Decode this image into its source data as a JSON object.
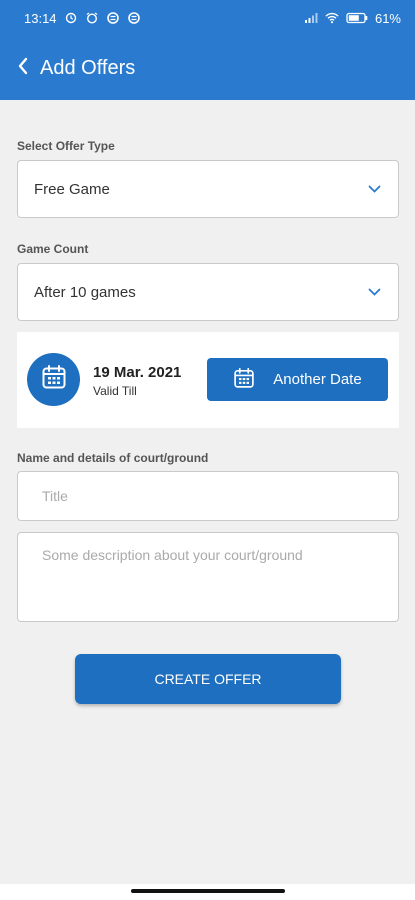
{
  "status_bar": {
    "time": "13:14",
    "battery": "61%",
    "left_icons": [
      "alarm-icon",
      "alarm-clock-icon",
      "notification-icon",
      "notification-icon"
    ],
    "right_icons": [
      "signal-icon",
      "wifi-icon",
      "battery-icon"
    ]
  },
  "header": {
    "title": "Add Offers",
    "back_icon": "chevron-left-icon"
  },
  "offer_type": {
    "label": "Select Offer Type",
    "value": "Free Game"
  },
  "game_count": {
    "label": "Game Count",
    "value": "After 10 games"
  },
  "validity": {
    "date": "19 Mar. 2021",
    "caption": "Valid Till",
    "button_label": "Another Date",
    "icon": "calendar-icon"
  },
  "court": {
    "label": "Name and details of court/ground",
    "title_placeholder": "Title",
    "description_placeholder": "Some description about your court/ground"
  },
  "actions": {
    "create_label": "CREATE OFFER"
  },
  "colors": {
    "primary": "#2a7bd0",
    "button": "#1e6fbf",
    "background": "#f0f0f0"
  }
}
